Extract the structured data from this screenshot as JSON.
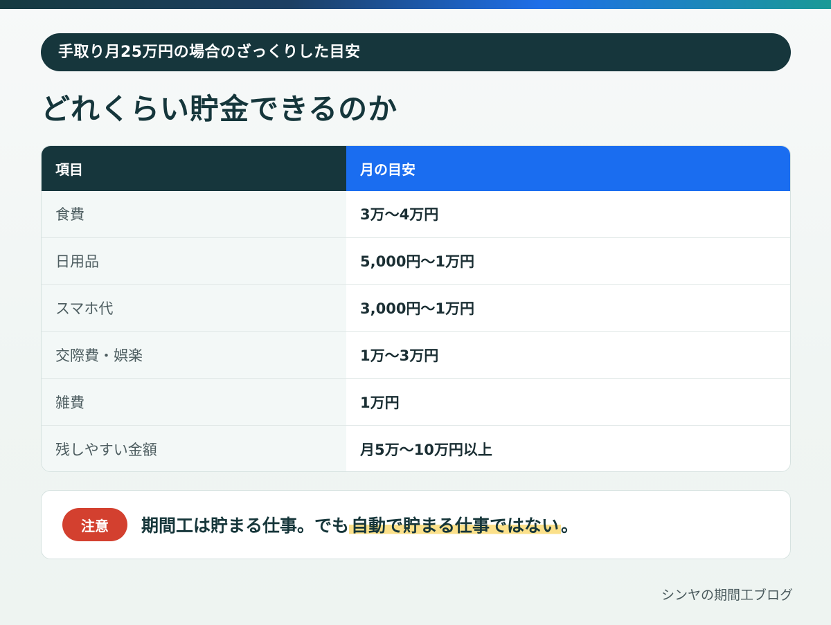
{
  "header": {
    "subtitle": "手取り月25万円の場合のざっくりした目安",
    "title": "どれくらい貯金できるのか"
  },
  "table": {
    "columns": [
      "項目",
      "月の目安"
    ],
    "rows": [
      {
        "item": "食費",
        "value": "3万〜4万円"
      },
      {
        "item": "日用品",
        "value": "5,000円〜1万円"
      },
      {
        "item": "スマホ代",
        "value": "3,000円〜1万円"
      },
      {
        "item": "交際費・娯楽",
        "value": "1万〜3万円"
      },
      {
        "item": "雑費",
        "value": "1万円"
      },
      {
        "item": "残しやすい金額",
        "value": "月5万〜10万円以上"
      }
    ]
  },
  "note": {
    "badge": "注意",
    "text_before": "期間工は貯まる仕事。でも",
    "text_highlight": "自動で貯まる仕事ではない",
    "text_after": "。"
  },
  "footer": {
    "brand": "シンヤの期間工ブログ"
  },
  "colors": {
    "dark_teal": "#16363c",
    "accent_blue": "#1a6df0",
    "badge_red": "#d3402f",
    "highlight_yellow": "#fbe08a"
  }
}
